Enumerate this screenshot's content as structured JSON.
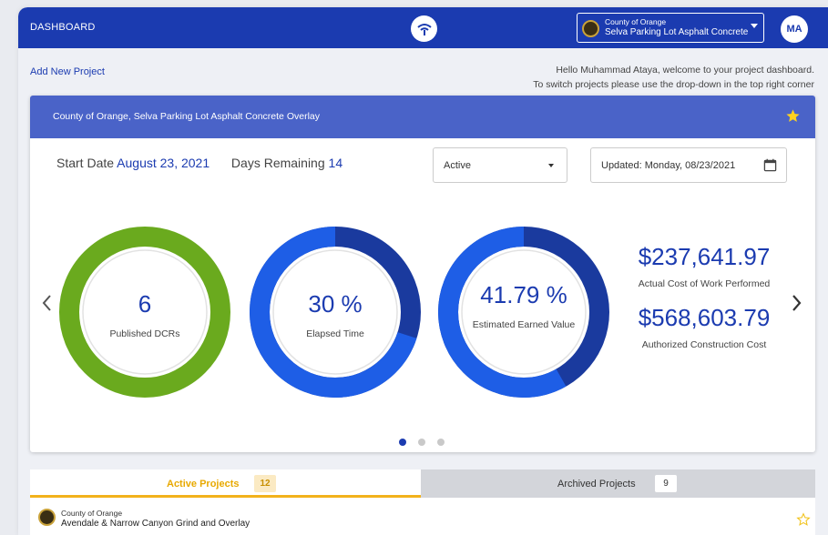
{
  "header": {
    "title": "DASHBOARD",
    "project_select": {
      "org": "County of Orange",
      "name": "Selva Parking Lot Asphalt Concrete Overlay"
    },
    "avatar_initials": "MA",
    "brand_color": "#1b3bb0"
  },
  "actions": {
    "add_project": "Add New Project"
  },
  "welcome": {
    "line1": "Hello Muhammad Ataya, welcome to your project dashboard.",
    "line2": "To switch projects please use the drop-down in the top right corner"
  },
  "project_card": {
    "title": "County of Orange, Selva Parking Lot Asphalt Concrete Overlay",
    "favorite": true,
    "start_label": "Start Date",
    "start_value": "August 23, 2021",
    "remaining_label": "Days Remaining",
    "remaining_value": "14",
    "status_value": "Active",
    "updated_value": "Updated: Monday, 08/23/2021",
    "metrics": [
      {
        "value": "6",
        "label": "Published DCRs",
        "fraction": 1.0,
        "color": "#6aaa1e"
      },
      {
        "value": "30 %",
        "label": "Elapsed Time",
        "fraction": 0.3,
        "color": "#1b3bb0"
      },
      {
        "value": "41.79 %",
        "label": "Estimated Earned Value",
        "fraction": 0.4179,
        "color": "#1b3bb0"
      }
    ],
    "costs": [
      {
        "amount": "$237,641.97",
        "label": "Actual Cost of Work Performed"
      },
      {
        "amount": "$568,603.79",
        "label": "Authorized Construction Cost"
      }
    ],
    "carousel": {
      "pages": 3,
      "current": 1
    }
  },
  "tabs": [
    {
      "label": "Active Projects",
      "count": "12",
      "active": true
    },
    {
      "label": "Archived Projects",
      "count": "9",
      "active": false
    }
  ],
  "project_list": [
    {
      "org": "County of Orange",
      "name": "Avendale & Narrow Canyon Grind and Overlay",
      "favorite": false
    }
  ],
  "icons": {
    "logo": "wifi-brand-icon",
    "star": "star-icon",
    "calendar": "calendar-icon",
    "prev": "chevron-left-icon",
    "next": "chevron-right-icon"
  }
}
